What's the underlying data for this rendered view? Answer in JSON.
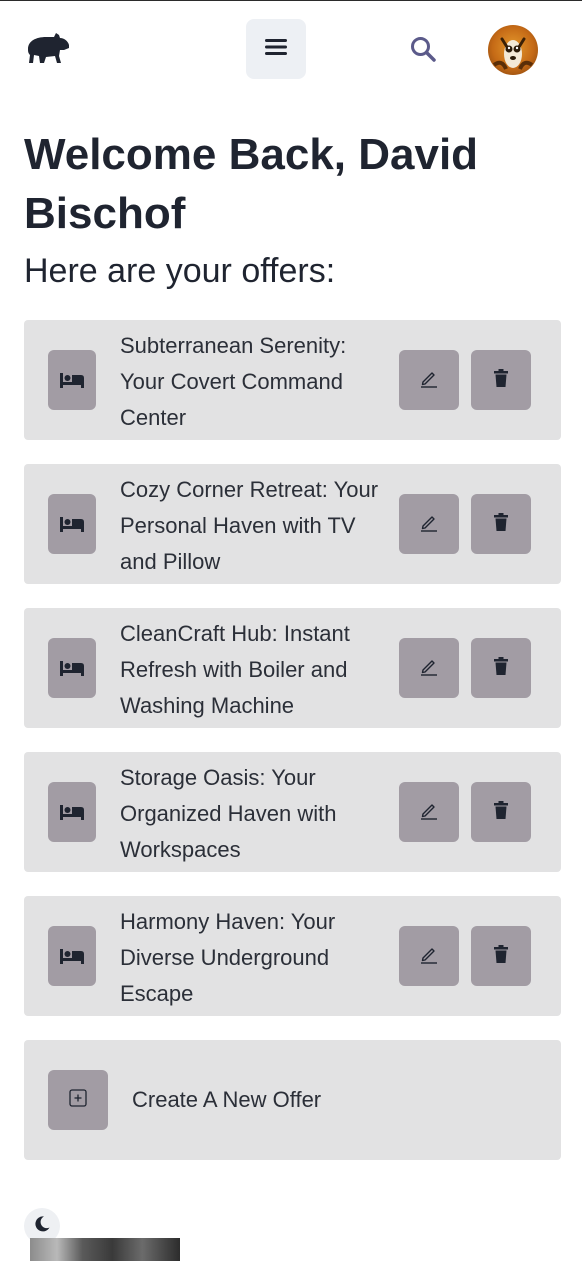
{
  "header": {
    "logo_icon": "capybara-logo-icon",
    "menu_icon": "hamburger-menu-icon",
    "search_icon": "search-icon",
    "avatar_icon": "user-avatar-icon"
  },
  "greeting": {
    "title": "Welcome Back, David Bischof",
    "subtitle": "Here are your offers:"
  },
  "offers": [
    {
      "title": "Subterranean Serenity: Your Covert Command Center",
      "icon": "bed-icon"
    },
    {
      "title": "Cozy Corner Retreat: Your Personal Haven with TV and Pillow",
      "icon": "bed-icon"
    },
    {
      "title": "CleanCraft Hub: Instant Refresh with Boiler and Washing Machine",
      "icon": "bed-icon"
    },
    {
      "title": "Storage Oasis: Your Organized Haven with Workspaces",
      "icon": "bed-icon"
    },
    {
      "title": "Harmony Haven: Your Diverse Underground Escape",
      "icon": "bed-icon"
    }
  ],
  "create_offer": {
    "label": "Create A New Offer",
    "icon": "plus-square-icon"
  },
  "footer": {
    "theme_toggle_icon": "moon-icon"
  },
  "colors": {
    "card_background": "#e2e2e3",
    "button_background": "#a29ca4",
    "text_dark": "#1f2430",
    "search_icon": "#5b5a8a",
    "menu_button_background": "#edf0f4"
  }
}
